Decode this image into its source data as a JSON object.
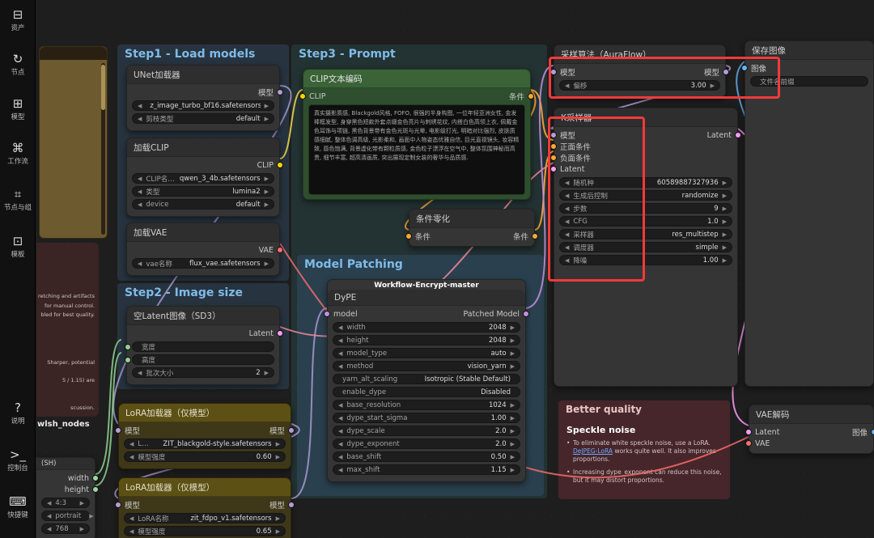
{
  "sidebar": {
    "items": [
      {
        "name": "assets",
        "glyph": "⊟",
        "label": "资产"
      },
      {
        "name": "nodes",
        "glyph": "↻",
        "label": "节点"
      },
      {
        "name": "models",
        "glyph": "⊞",
        "label": "模型"
      },
      {
        "name": "workflow",
        "glyph": "⌘",
        "label": "工作流"
      },
      {
        "name": "node-groups",
        "glyph": "⌗",
        "label": "节点与组"
      },
      {
        "name": "templates",
        "glyph": "⊡",
        "label": "模板"
      }
    ],
    "bottom": [
      {
        "name": "help",
        "glyph": "?",
        "label": "说明"
      },
      {
        "name": "console",
        "glyph": ">_",
        "label": "控制台"
      },
      {
        "name": "shortcuts",
        "glyph": "⌨",
        "label": "快捷键"
      }
    ]
  },
  "groups": {
    "step1": {
      "title": "Step1 - Load models"
    },
    "step2": {
      "title": "Step2 - Image size"
    },
    "step3": {
      "title": "Step3 - Prompt"
    },
    "patching": {
      "title": "Model Patching"
    },
    "better": {
      "title": "Better quality"
    }
  },
  "highlight_color": "#f23a3a",
  "nodes": {
    "unet": {
      "title": "UNet加载器",
      "slotRows": [
        {
          "out": {
            "name": "模型",
            "color": "#b39ddb"
          }
        }
      ],
      "widgets": [
        {
          "value": "z_image_turbo_bf16.safetensors"
        },
        {
          "label": "剪枝类型",
          "value": "default"
        }
      ]
    },
    "clip": {
      "title": "加载CLIP",
      "slotRows": [
        {
          "out": {
            "name": "CLIP",
            "color": "#ffd500"
          }
        }
      ],
      "widgets": [
        {
          "label": "CLIP名…",
          "value": "qwen_3_4b.safetensors"
        },
        {
          "label": "类型",
          "value": "lumina2"
        },
        {
          "label": "device",
          "value": "default"
        }
      ]
    },
    "vae": {
      "title": "加载VAE",
      "slotRows": [
        {
          "out": {
            "name": "VAE",
            "color": "#ff6e6e"
          }
        }
      ],
      "widgets": [
        {
          "label": "vae名称",
          "value": "flux_vae.safetensors"
        }
      ]
    },
    "latent": {
      "title": "空Latent图像（SD3）",
      "slotRows": [
        {
          "out": {
            "name": "Latent",
            "color": "#ff9cf9"
          }
        }
      ],
      "widgets": [
        {
          "label": "宽度",
          "value": "",
          "arrows": false,
          "dot": "#8fd48f"
        },
        {
          "label": "高度",
          "value": "",
          "arrows": false,
          "dot": "#8fd48f"
        },
        {
          "label": "批次大小",
          "value": "2"
        }
      ]
    },
    "lora1": {
      "title": "LoRA加载器（仅模型）",
      "slotRows": [
        {
          "in": {
            "name": "模型",
            "color": "#b39ddb"
          },
          "out": {
            "name": "模型",
            "color": "#b39ddb"
          }
        }
      ],
      "widgets": [
        {
          "label": "L…",
          "value": "ZIT_blackgold-style.safetensors"
        },
        {
          "label": "模型强度",
          "value": "0.60"
        }
      ]
    },
    "lora2": {
      "title": "LoRA加载器（仅模型）",
      "slotRows": [
        {
          "in": {
            "name": "模型",
            "color": "#b39ddb"
          },
          "out": {
            "name": "模型",
            "color": "#b39ddb"
          }
        }
      ],
      "widgets": [
        {
          "label": "LoRA名称",
          "value": "zit_fdpo_v1.safetensors"
        },
        {
          "label": "模型强度",
          "value": "0.65"
        }
      ]
    },
    "clip_encode": {
      "title": "CLIP文本编码",
      "slotRows": [
        {
          "in": {
            "name": "CLIP",
            "color": "#ffd500"
          },
          "out": {
            "name": "条件",
            "color": "#ffa931"
          }
        }
      ],
      "text": "真实摄影质感, Blackgold风格, FOFO, 很强的半身构图, 一位年轻亚洲女性, 金发棒框发型, 身穿黑色短款外套点缀金色亮片与刺绣花纹, 内搭白色高领上衣, 佩戴金色耳饰与项链, 黑色背景带有金色光斑与光晕, 电影级打光, 明暗对比强烈, 皮肤质感细腻, 整体色调高级, 光影柔和, 画面中人物姿态优雅自信, 目光直视镜头, 妆容精致, 唇色饱满, 背景虚化带有颗粒质感, 金色粒子漂浮在空气中, 整体氛围神秘而高贵, 细节丰富, 超高清画质, 突出展现定制女装的奢华与品质感."
    },
    "cond_zero": {
      "title": "条件零化",
      "slotRows": [
        {
          "in": {
            "name": "条件",
            "color": "#ffa931"
          },
          "out": {
            "name": "条件",
            "color": "#ffa931"
          }
        }
      ]
    },
    "dype": {
      "overtitle": "Workflow-Encrypt-master",
      "title": "DyPE",
      "slotRows": [
        {
          "in": {
            "name": "model",
            "color": "#c48fe0"
          },
          "out": {
            "name": "Patched Model",
            "color": "#c48fe0"
          }
        }
      ],
      "widgets": [
        {
          "label": "width",
          "value": "2048"
        },
        {
          "label": "height",
          "value": "2048"
        },
        {
          "label": "model_type",
          "value": "auto"
        },
        {
          "label": "method",
          "value": "vision_yarn"
        },
        {
          "label": "yarn_alt_scaling",
          "value": "Isotropic (Stable Default)",
          "arrows": false
        },
        {
          "label": "enable_dype",
          "value": "Disabled",
          "arrows": false
        },
        {
          "label": "base_resolution",
          "value": "1024"
        },
        {
          "label": "dype_start_sigma",
          "value": "1.00"
        },
        {
          "label": "dype_scale",
          "value": "2.0"
        },
        {
          "label": "dype_exponent",
          "value": "2.0"
        },
        {
          "label": "base_shift",
          "value": "0.50"
        },
        {
          "label": "max_shift",
          "value": "1.15"
        }
      ]
    },
    "aura": {
      "title": "采样算法（AuraFlow）",
      "slotRows": [
        {
          "in": {
            "name": "模型",
            "color": "#b39ddb"
          },
          "out": {
            "name": "模型",
            "color": "#b39ddb"
          }
        }
      ],
      "widgets": [
        {
          "label": "偏移",
          "value": "3.00"
        }
      ]
    },
    "ksampler": {
      "title": "K采样器",
      "slotRows": [
        {
          "in": {
            "name": "模型",
            "color": "#b39ddb"
          },
          "out": {
            "name": "Latent",
            "color": "#ff9cf9"
          }
        },
        {
          "in": {
            "name": "正面条件",
            "color": "#ffa931"
          }
        },
        {
          "in": {
            "name": "负面条件",
            "color": "#ffa931"
          }
        },
        {
          "in": {
            "name": "Latent",
            "color": "#ff9cf9"
          }
        }
      ],
      "widgets": [
        {
          "label": "随机种",
          "value": "60589887327936"
        },
        {
          "label": "生成后控制",
          "value": "randomize"
        },
        {
          "label": "步数",
          "value": "9"
        },
        {
          "label": "CFG",
          "value": "1.0"
        },
        {
          "label": "采样器",
          "value": "res_multistep"
        },
        {
          "label": "调度器",
          "value": "simple"
        },
        {
          "label": "降噪",
          "value": "1.00"
        }
      ]
    },
    "save": {
      "title": "保存图像",
      "slotRows": [
        {
          "in": {
            "name": "图像",
            "color": "#64b5f6"
          }
        }
      ],
      "widgets": [
        {
          "label": "文件名前缀",
          "value": "",
          "arrows": false
        }
      ]
    },
    "vaedec": {
      "title": "VAE解码",
      "slotRows": [
        {
          "in": {
            "name": "Latent",
            "color": "#ff9cf9"
          },
          "out": {
            "name": "图像",
            "color": "#64b5f6"
          }
        },
        {
          "in": {
            "name": "VAE",
            "color": "#ff6e6e"
          }
        }
      ]
    },
    "sh": {
      "title": "(SH)",
      "slotRows": [
        {
          "out": {
            "name": "width",
            "color": "#9fd79f"
          }
        },
        {
          "out": {
            "name": "height",
            "color": "#9fd79f"
          }
        }
      ],
      "widgets": [
        {
          "label": "4:3",
          "value": ""
        },
        {
          "label": "portrait",
          "value": ""
        },
        {
          "label": "768",
          "value": ""
        }
      ]
    }
  },
  "better_note": {
    "heading": "Speckle noise",
    "p1_pre": "To eliminate white speckle noise, use a LoRA. ",
    "p1_link": "DeJPEG-LoRA",
    "p1_post": " works quite well. It also improves proportions.",
    "p2": "Increasing dype_exponent can reduce this noise, but it may distort proportions."
  },
  "left_note": {
    "lines": [
      "retching and artifacts",
      "for manual control.",
      "bled for best quality.",
      "Sharper, potential",
      "5 / 1.15) are",
      "scussion."
    ]
  },
  "misc": {
    "wlsh": "wlsh_nodes"
  }
}
